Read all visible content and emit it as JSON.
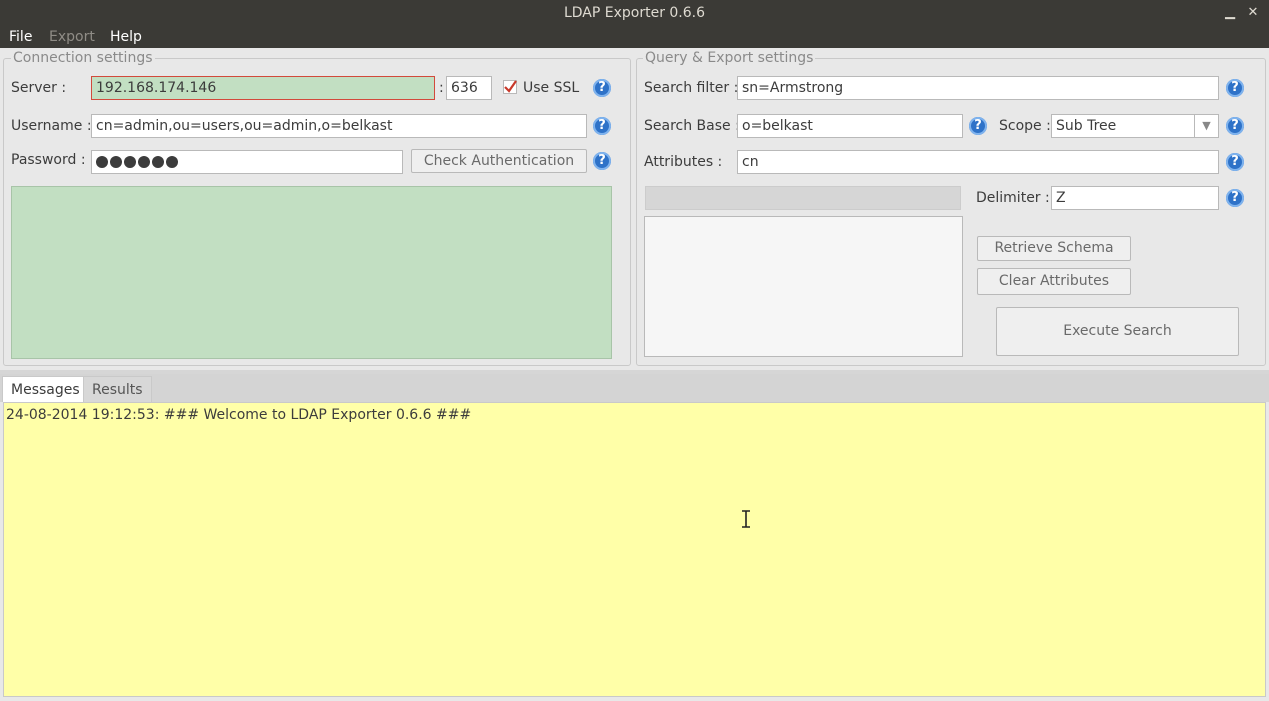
{
  "window": {
    "title": "LDAP Exporter 0.6.6",
    "minimize": "▁",
    "close": "✕"
  },
  "menu": {
    "file": "File",
    "export": "Export",
    "help": "Help"
  },
  "connection": {
    "legend": "Connection settings",
    "server_label": "Server :",
    "server_value": "192.168.174.146",
    "port_sep": ":",
    "port_value": "636",
    "ssl_label": "Use SSL",
    "ssl_checked": true,
    "username_label": "Username :",
    "username_value": "cn=admin,ou=users,ou=admin,o=belkast",
    "password_label": "Password :",
    "password_mask_count": 6,
    "check_auth_label": "Check Authentication",
    "status_color": "#c2dfc2"
  },
  "query": {
    "legend": "Query & Export settings",
    "filter_label": "Search filter :",
    "filter_value": "sn=Armstrong",
    "base_label": "Search Base :",
    "base_value": "o=belkast",
    "scope_label": "Scope :",
    "scope_value": "Sub Tree",
    "attributes_label": "Attributes :",
    "attributes_value": "cn",
    "delimiter_label": "Delimiter :",
    "delimiter_value": "Z",
    "retrieve_label": "Retrieve Schema",
    "clear_label": "Clear Attributes",
    "execute_label": "Execute Search"
  },
  "tabs": {
    "messages": "Messages",
    "results": "Results"
  },
  "messages": {
    "line1": "24-08-2014 19:12:53: ### Welcome to LDAP Exporter 0.6.6 ###"
  },
  "colors": {
    "accent": "#2e72c8",
    "message_bg": "#ffffa8",
    "error_border": "#d24a3c"
  }
}
